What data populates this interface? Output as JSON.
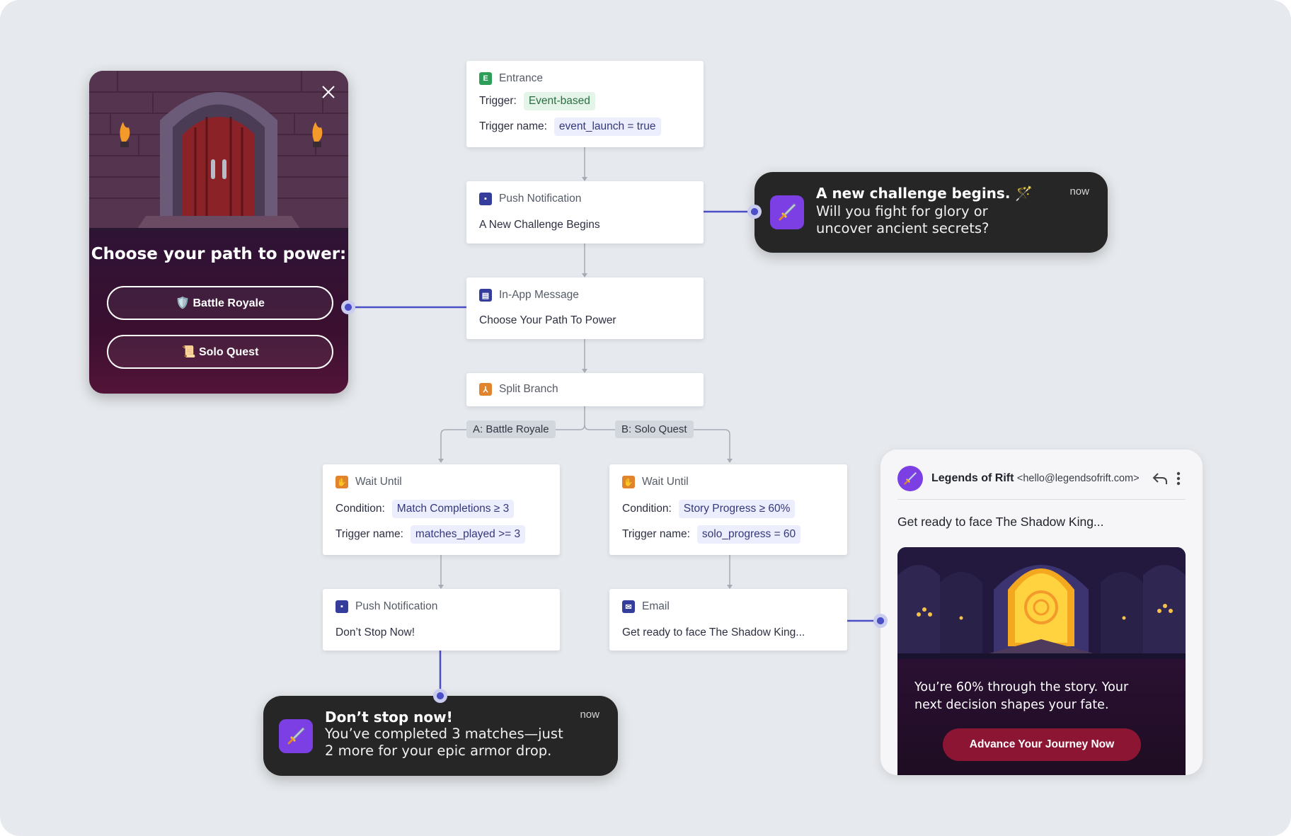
{
  "entrance": {
    "title": "Entrance",
    "trigger_label": "Trigger:",
    "trigger_value": "Event-based",
    "trigger_name_label": "Trigger name:",
    "trigger_name_value": "event_launch = true"
  },
  "push1": {
    "title": "Push Notification",
    "text": "A New Challenge Begins"
  },
  "inapp_node": {
    "title": "In-App Message",
    "text": "Choose Your Path To Power"
  },
  "split": {
    "title": "Split Branch",
    "branch_a": "A: Battle Royale",
    "branch_b": "B: Solo Quest"
  },
  "wait_a": {
    "title": "Wait Until",
    "condition_label": "Condition:",
    "condition_value": "Match Completions ≥ 3",
    "trigger_name_label": "Trigger name:",
    "trigger_name_value": "matches_played >= 3"
  },
  "wait_b": {
    "title": "Wait Until",
    "condition_label": "Condition:",
    "condition_value": "Story Progress ≥ 60%",
    "trigger_name_label": "Trigger name:",
    "trigger_name_value": "solo_progress = 60"
  },
  "push2": {
    "title": "Push Notification",
    "text": "Don’t Stop Now!"
  },
  "email_node": {
    "title": "Email",
    "text": "Get ready to face The Shadow King..."
  },
  "notif_top": {
    "title": "A new challenge begins. 🪄",
    "message": "Will you fight for glory or uncover ancient secrets?",
    "time": "now",
    "icon": "sword-icon"
  },
  "notif_bottom": {
    "title": "Don’t stop now!",
    "message": "You’ve completed 3 matches—just 2 more for your epic armor drop.",
    "time": "now",
    "icon": "sword-icon"
  },
  "inapp_modal": {
    "heading": "Choose your path to power:",
    "option1": "🛡️ Battle Royale",
    "option2": "📜 Solo Quest",
    "close_icon": "close-icon"
  },
  "email_preview": {
    "sender_name": "Legends of Rift",
    "sender_email": "<hello@legendsofrift.com>",
    "subject": "Get ready to face The Shadow King...",
    "body": "You’re 60% through the story. Your next decision shapes your fate.",
    "cta": "Advance Your Journey Now"
  },
  "colors": {
    "canvas": "#e6e9ed",
    "accent": "#4b4fc7",
    "notif_bg": "#262626",
    "app_icon": "#7b3fe4",
    "cta": "#8c1534"
  }
}
